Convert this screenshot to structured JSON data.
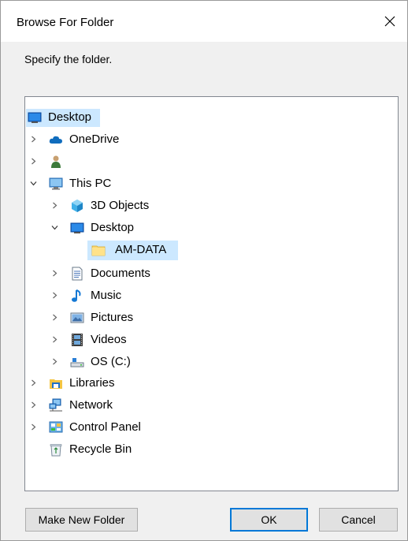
{
  "dialog": {
    "title": "Browse For Folder",
    "instruction": "Specify the folder."
  },
  "tree": {
    "items": [
      {
        "label": "Desktop",
        "icon": "desktop-icon",
        "level": 0,
        "expander": "none",
        "highlight": "light"
      },
      {
        "label": "OneDrive",
        "icon": "onedrive-cloud-icon",
        "level": 0,
        "expander": "collapsed"
      },
      {
        "label": "",
        "icon": "user-icon",
        "level": 0,
        "expander": "collapsed"
      },
      {
        "label": "This PC",
        "icon": "this-pc-icon",
        "level": 0,
        "expander": "expanded"
      },
      {
        "label": "3D Objects",
        "icon": "3d-objects-icon",
        "level": 1,
        "expander": "collapsed"
      },
      {
        "label": "Desktop",
        "icon": "desktop-icon",
        "level": 1,
        "expander": "expanded"
      },
      {
        "label": "AM-DATA",
        "icon": "folder-icon",
        "level": 2,
        "expander": "none",
        "highlight": "selected"
      },
      {
        "label": "Documents",
        "icon": "documents-icon",
        "level": 1,
        "expander": "collapsed"
      },
      {
        "label": "Music",
        "icon": "music-icon",
        "level": 1,
        "expander": "collapsed"
      },
      {
        "label": "Pictures",
        "icon": "pictures-icon",
        "level": 1,
        "expander": "collapsed"
      },
      {
        "label": "Videos",
        "icon": "videos-icon",
        "level": 1,
        "expander": "collapsed"
      },
      {
        "label": "OS (C:)",
        "icon": "drive-icon",
        "level": 1,
        "expander": "collapsed"
      },
      {
        "label": "Libraries",
        "icon": "libraries-icon",
        "level": 0,
        "expander": "collapsed"
      },
      {
        "label": "Network",
        "icon": "network-icon",
        "level": 0,
        "expander": "collapsed"
      },
      {
        "label": "Control Panel",
        "icon": "control-panel-icon",
        "level": 0,
        "expander": "collapsed"
      },
      {
        "label": "Recycle Bin",
        "icon": "recycle-bin-icon",
        "level": 0,
        "expander": "none"
      }
    ]
  },
  "buttons": {
    "make_new_folder": "Make New Folder",
    "ok": "OK",
    "cancel": "Cancel"
  },
  "colors": {
    "selection": "#cce8ff",
    "desktop_highlight": "#cce8ff",
    "accent": "#0078d7"
  }
}
